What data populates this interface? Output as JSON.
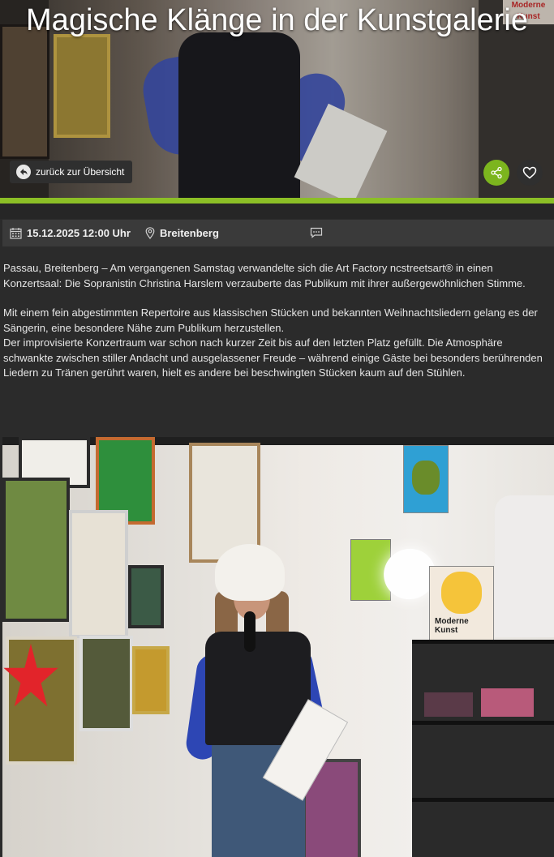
{
  "hero": {
    "title": "Magische Klänge in der Kunstgalerie",
    "back_label": "zurück zur Übersicht",
    "shelf_sign": "Moderne Kunst"
  },
  "meta": {
    "date": "15.12.2025 12:00 Uhr",
    "location": "Breitenberg"
  },
  "article": {
    "paragraphs": [
      "Passau, Breitenberg – Am vergangenen Samstag verwandelte sich die Art Factory ncstreetsart® in einen Konzertsaal: Die Sopranistin Christina Harslem verzauberte das Publikum mit ihrer außergewöhnlichen Stimme.",
      "Mit einem fein abgestimmten Repertoire aus klassischen Stücken und bekannten Weihnachtsliedern gelang es der Sängerin, eine besondere Nähe zum Publikum herzustellen.",
      "Der improvisierte Konzertraum war schon nach kurzer Zeit bis auf den letzten Platz gefüllt. Die Atmosphäre schwankte zwischen stiller Andacht und ausgelassener Freude – während einige Gäste bei besonders berührenden Liedern zu Tränen gerührt waren, hielt es andere bei beschwingten Stücken kaum auf den Stühlen."
    ]
  },
  "photo": {
    "poster_text": "Moderne Kunst"
  },
  "colors": {
    "accent": "#8cbf26",
    "share_button": "#7cb51e",
    "background": "#2b2b2b",
    "meta_bar": "#3a3a3a"
  },
  "icons": [
    "back-arrow-icon",
    "share-icon",
    "heart-icon",
    "calendar-icon",
    "location-pin-icon",
    "comment-icon"
  ]
}
